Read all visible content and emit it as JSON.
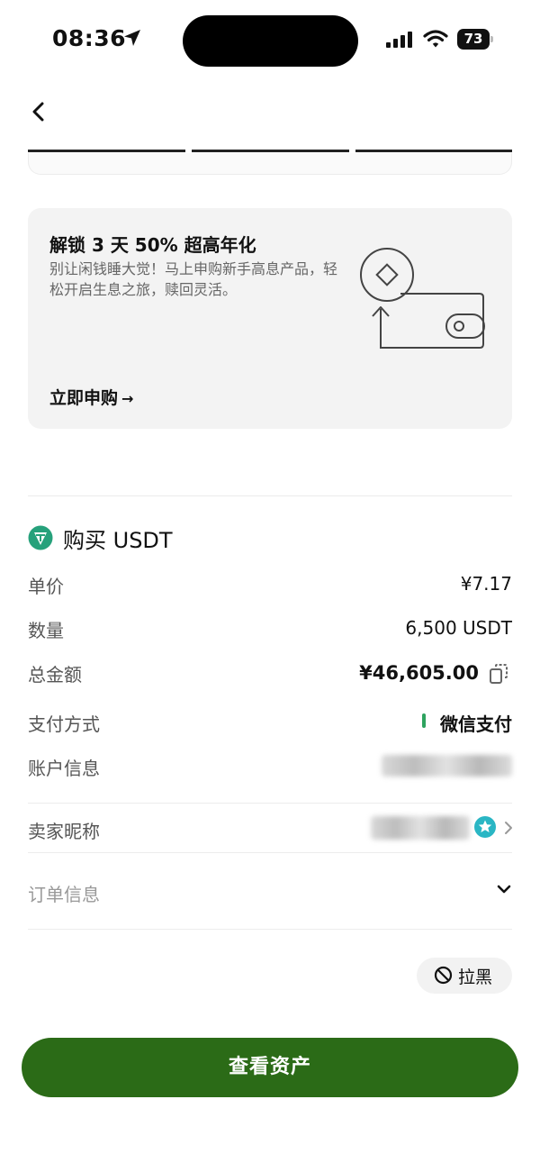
{
  "status_bar": {
    "time": "08:36",
    "battery": "73"
  },
  "promo": {
    "title": "解锁 3 天 50% 超高年化",
    "description": "别让闲钱睡大觉！马上申购新手高息产品，轻松开启生息之旅，赎回灵活。",
    "cta": "立即申购",
    "cta_arrow": "→"
  },
  "order": {
    "title": "购买 USDT",
    "rows": {
      "price": {
        "label": "单价",
        "value": "¥7.17"
      },
      "quantity": {
        "label": "数量",
        "value": "6,500 USDT"
      },
      "total": {
        "label": "总金额",
        "value": "¥46,605.00"
      },
      "payment": {
        "label": "支付方式",
        "value": "微信支付"
      },
      "account": {
        "label": "账户信息"
      },
      "seller": {
        "label": "卖家昵称"
      },
      "order_info": {
        "label": "订单信息"
      }
    }
  },
  "block_button": {
    "label": "拉黑"
  },
  "main_button": {
    "label": "查看资产"
  },
  "colors": {
    "primary": "#2b6b17",
    "payment_accent": "#2ea35f",
    "coin": "#26a17b"
  },
  "icons": [
    "location-arrow-icon",
    "signal-icon",
    "wifi-icon",
    "back-icon",
    "coin-icon",
    "copy-icon",
    "star-badge-icon",
    "chevron-right-icon",
    "chevron-down-icon",
    "block-icon"
  ]
}
